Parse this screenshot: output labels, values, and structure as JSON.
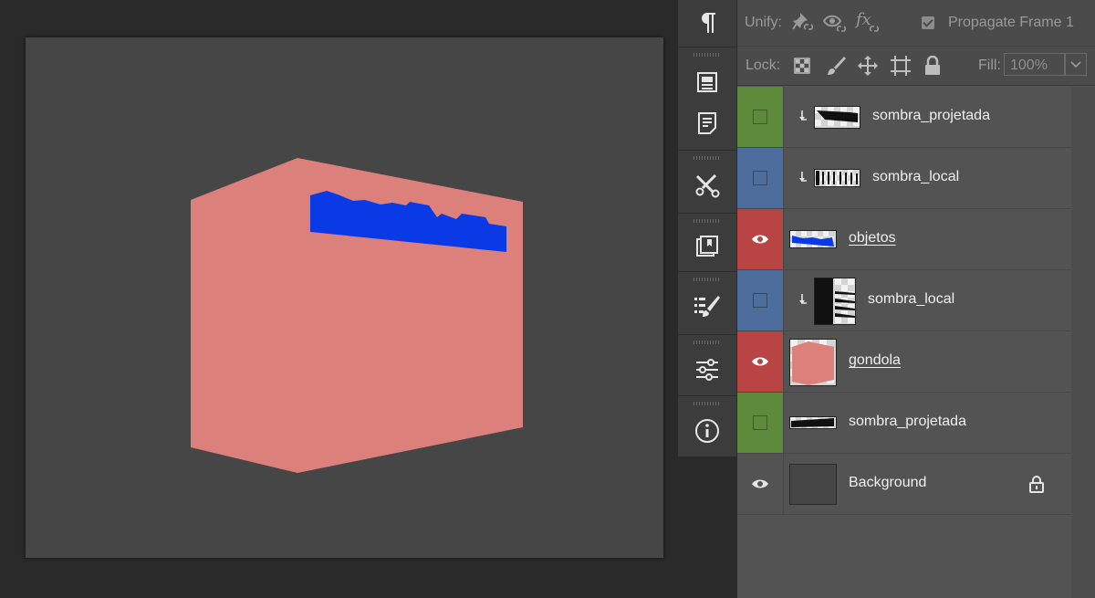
{
  "colors": {
    "canvas_bg": "#464646",
    "gondola": "#db807a",
    "objects": "#0a3ae6",
    "label_green": "#5e8a3c",
    "label_blue": "#4d6d9c",
    "label_red": "#b84443"
  },
  "unify_bar": {
    "unify_label": "Unify:",
    "icons": [
      "pin-position-icon",
      "eye-visibility-icon",
      "fx-style-icon"
    ],
    "propagate_label": "Propagate Frame 1",
    "propagate_checked": true
  },
  "lock_bar": {
    "lock_label": "Lock:",
    "icons": [
      "lock-transparent-pixels-icon",
      "lock-image-pixels-icon",
      "lock-position-icon",
      "lock-artboard-icon",
      "lock-all-icon"
    ],
    "fill_label": "Fill:",
    "fill_value": "100%"
  },
  "tool_strip": {
    "icons": [
      "paragraph-icon",
      "properties-icon",
      "notes-icon",
      "tools-icon",
      "libraries-icon",
      "brush-settings-icon",
      "adjustments-icon",
      "info-icon"
    ]
  },
  "layers": [
    {
      "name": "sombra_projetada",
      "label": "green",
      "visible": false,
      "clipped": true,
      "thumb": "shadow-bar-icon"
    },
    {
      "name": "sombra_local",
      "label": "blue",
      "visible": false,
      "clipped": true,
      "thumb": "shadow-stripes-icon"
    },
    {
      "name": "objetos",
      "label": "red",
      "visible": true,
      "clipped": false,
      "thumb": "objects-icon"
    },
    {
      "name": "sombra_local",
      "label": "blue",
      "visible": false,
      "clipped": true,
      "thumb": "shadow-side-icon"
    },
    {
      "name": "gondola",
      "label": "red",
      "visible": true,
      "clipped": false,
      "thumb": "gondola-icon"
    },
    {
      "name": "sombra_projetada",
      "label": "green",
      "visible": false,
      "clipped": false,
      "thumb": "shadow-floor-icon"
    },
    {
      "name": "Background",
      "label": "none",
      "visible": true,
      "clipped": false,
      "locked": true,
      "thumb": "background-icon"
    }
  ]
}
